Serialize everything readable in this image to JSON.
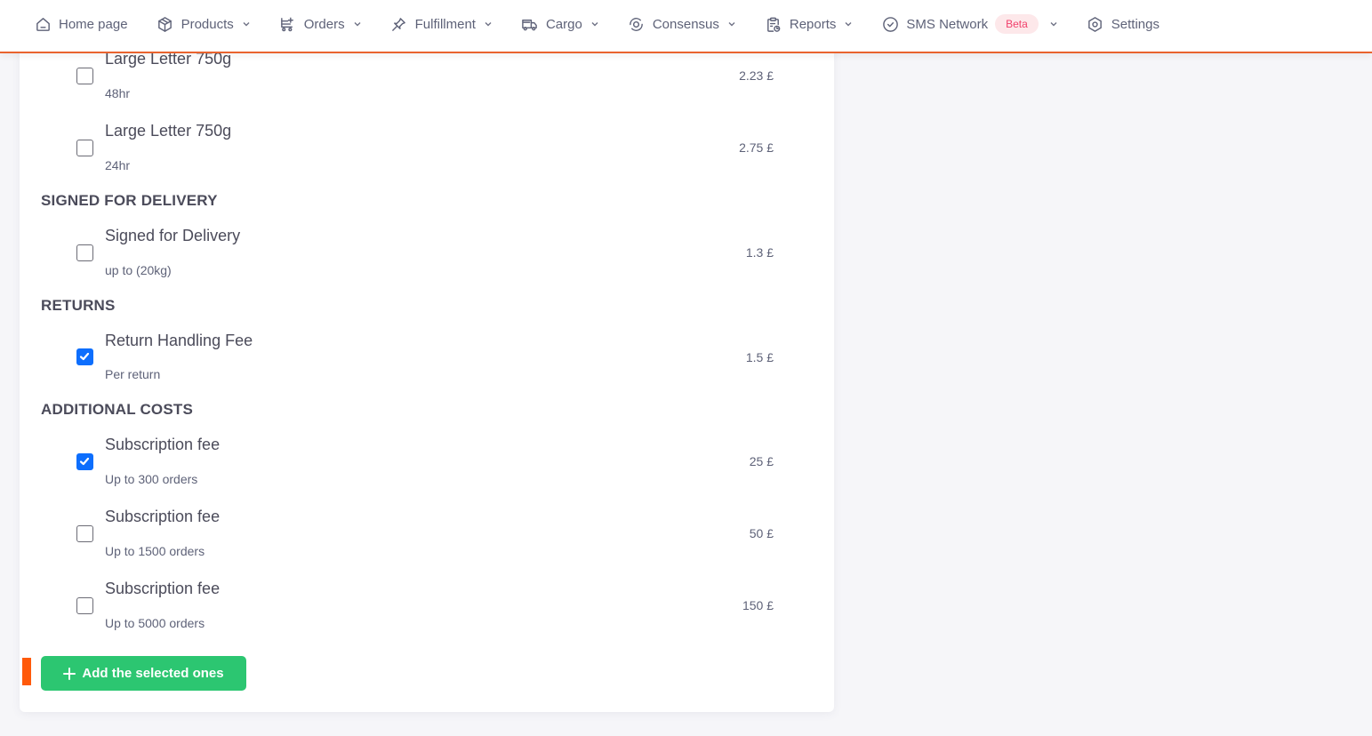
{
  "nav": {
    "items": [
      {
        "label": "Home page",
        "icon": "home-icon",
        "has_dropdown": false
      },
      {
        "label": "Products",
        "icon": "box-icon",
        "has_dropdown": true
      },
      {
        "label": "Orders",
        "icon": "cart-icon",
        "has_dropdown": true
      },
      {
        "label": "Fulfillment",
        "icon": "pin-icon",
        "has_dropdown": true
      },
      {
        "label": "Cargo",
        "icon": "truck-icon",
        "has_dropdown": true
      },
      {
        "label": "Consensus",
        "icon": "target-icon",
        "has_dropdown": true
      },
      {
        "label": "Reports",
        "icon": "clipboard-clock-icon",
        "has_dropdown": true
      },
      {
        "label": "SMS Network",
        "icon": "check-circle-icon",
        "has_dropdown": true,
        "badge": "Beta"
      },
      {
        "label": "Settings",
        "icon": "gear-hexagon-icon",
        "has_dropdown": false
      }
    ]
  },
  "colors": {
    "accent": "#e9632e",
    "checkbox_checked": "#0d6efd",
    "button_green": "#2cc671",
    "badge_bg": "#fde8ea",
    "badge_text": "#f1416c"
  },
  "sections": [
    {
      "title": null,
      "items": [
        {
          "title": "Large Letter 750g",
          "subtitle": "48hr",
          "price": "2.23 £",
          "checked": false
        },
        {
          "title": "Large Letter 750g",
          "subtitle": "24hr",
          "price": "2.75 £",
          "checked": false
        }
      ]
    },
    {
      "title": "SIGNED FOR DELIVERY",
      "items": [
        {
          "title": "Signed for Delivery",
          "subtitle": "up to (20kg)",
          "price": "1.3 £",
          "checked": false
        }
      ]
    },
    {
      "title": "RETURNS",
      "items": [
        {
          "title": "Return Handling Fee",
          "subtitle": "Per return",
          "price": "1.5 £",
          "checked": true
        }
      ]
    },
    {
      "title": "ADDITIONAL COSTS",
      "items": [
        {
          "title": "Subscription fee",
          "subtitle": "Up to 300 orders",
          "price": "25 £",
          "checked": true
        },
        {
          "title": "Subscription fee",
          "subtitle": "Up to 1500 orders",
          "price": "50 £",
          "checked": false
        },
        {
          "title": "Subscription fee",
          "subtitle": "Up to 5000 orders",
          "price": "150 £",
          "checked": false
        }
      ]
    }
  ],
  "actions": {
    "add_selected_label": "Add the selected ones"
  }
}
